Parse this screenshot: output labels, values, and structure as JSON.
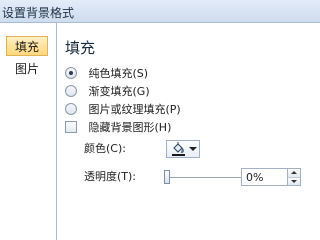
{
  "window": {
    "title": "设置背景格式"
  },
  "sidebar": {
    "items": [
      {
        "label": "填充",
        "active": true
      },
      {
        "label": "图片",
        "active": false
      }
    ]
  },
  "fill": {
    "section_title": "填充",
    "options": [
      {
        "label": "纯色填充(S)",
        "checked": true
      },
      {
        "label": "渐变填充(G)",
        "checked": false
      },
      {
        "label": "图片或纹理填充(P)",
        "checked": false
      }
    ],
    "hide_background": {
      "label": "隐藏背景图形(H)",
      "checked": false
    },
    "color_label": "颜色(C):",
    "transparency_label": "透明度(T):",
    "transparency_value": "0%",
    "transparency_level": 0
  },
  "icons": {
    "paint_bucket": "paint-bucket-icon",
    "dropdown": "chevron-down-icon"
  },
  "colors": {
    "accent_selected": "#ffd77a",
    "panel_bg": "#c9d9ee"
  }
}
